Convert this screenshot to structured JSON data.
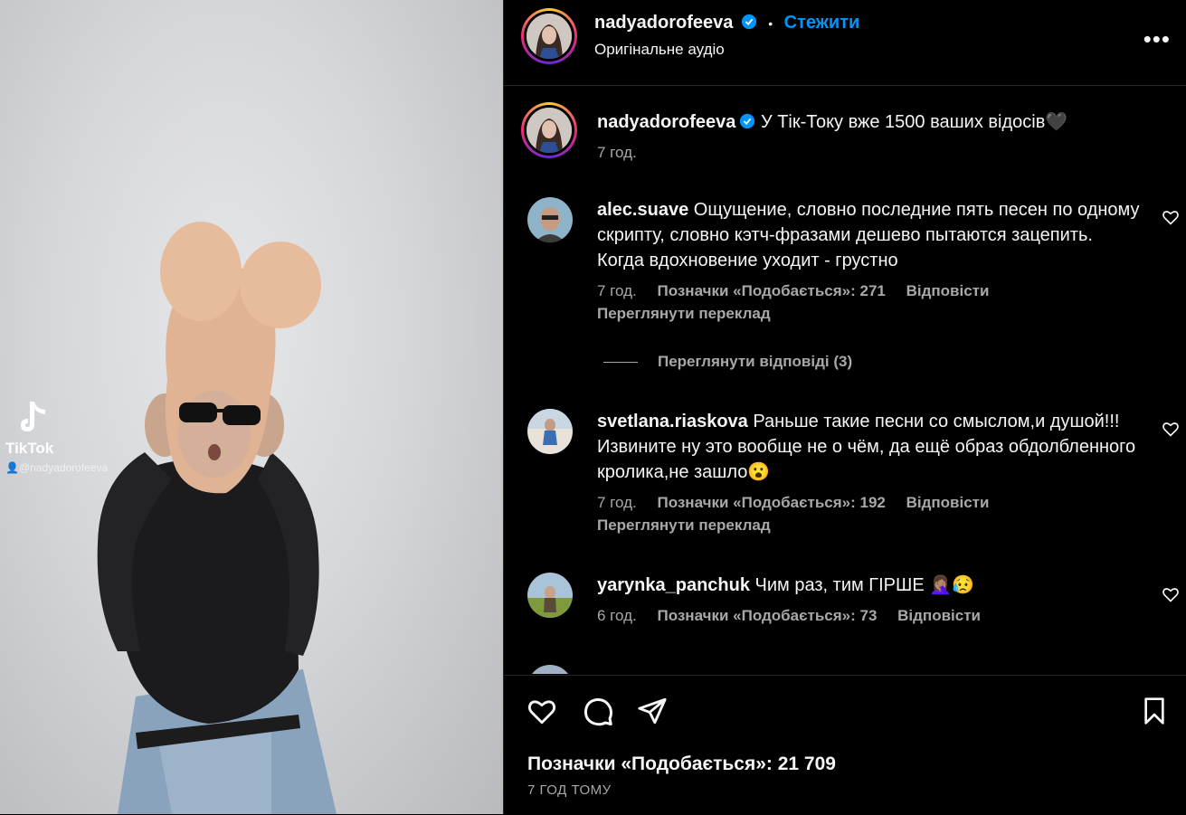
{
  "media": {
    "watermark_brand": "TikTok",
    "watermark_handle": "@nadyadorofeeva"
  },
  "header": {
    "username": "nadyadorofeeva",
    "dot": "•",
    "follow_label": "Стежити",
    "audio_label": "Оригінальне аудіо",
    "more_label": "•••"
  },
  "caption": {
    "username": "nadyadorofeeva",
    "text": "У Тік-Току вже 1500 ваших відосів🖤",
    "time": "7 год."
  },
  "comments": [
    {
      "username": "alec.suave",
      "text": "Ощущение, словно последние пять песен по одному скрипту, словно кэтч-фразами дешево пытаются зацепить. Когда вдохновение уходит - грустно",
      "time": "7 год.",
      "likes": "Позначки «Подобається»: 271",
      "reply": "Відповісти",
      "translate": "Переглянути переклад",
      "view_replies": "Переглянути відповіді (3)"
    },
    {
      "username": "svetlana.riaskova",
      "text": "Раньше такие песни со смыслом,и душой!!!Извините ну это вообще не о чём, да ещё образ обдолбленного кролика,не зашло😮",
      "time": "7 год.",
      "likes": "Позначки «Подобається»: 192",
      "reply": "Відповісти",
      "translate": "Переглянути переклад"
    },
    {
      "username": "yarynka_panchuk",
      "text": "Чим раз, тим ГІРШЕ 🤦🏽‍♀️😥",
      "time": "6 год.",
      "likes": "Позначки «Подобається»: 73",
      "reply": "Відповісти"
    }
  ],
  "footer": {
    "likes": "Позначки «Подобається»: 21 709",
    "posted": "7 ГОД ТОМУ"
  },
  "icons": {
    "like": "heart-icon",
    "comment": "comment-icon",
    "share": "send-icon",
    "save": "bookmark-icon",
    "verified": "verified-badge-icon"
  },
  "colors": {
    "background": "#000000",
    "accent": "#0095f6",
    "secondary_text": "#a8a8a8",
    "divider": "#262626"
  }
}
